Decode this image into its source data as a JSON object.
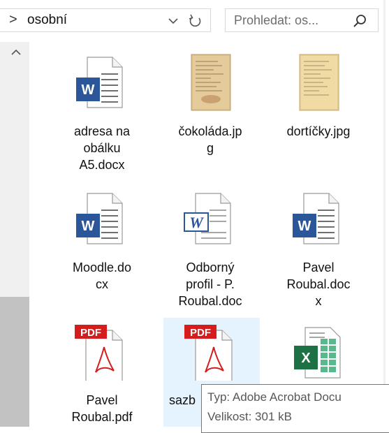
{
  "address_bar": {
    "separator": ">",
    "current_folder": "osobní"
  },
  "search": {
    "placeholder": "Prohledat: os..."
  },
  "files": [
    {
      "name": "adresa na obálku A5.docx",
      "lines": [
        "adresa na",
        "obálku",
        "A5.docx"
      ],
      "icon": "word-doc-icon"
    },
    {
      "name": "čokoláda.jpg",
      "lines": [
        "čokoláda.jp",
        "g"
      ],
      "icon": "image-thumbnail-icon"
    },
    {
      "name": "dortíčky.jpg",
      "lines": [
        "dortíčky.jpg"
      ],
      "icon": "image-thumbnail-icon"
    },
    {
      "name": "Moodle.docx",
      "lines": [
        "Moodle.do",
        "cx"
      ],
      "icon": "word-doc-icon"
    },
    {
      "name": "Odborný profil - P. Roubal.doc",
      "lines": [
        "Odborný",
        "profil - P.",
        "Roubal.doc"
      ],
      "icon": "word-legacy-doc-icon"
    },
    {
      "name": "Pavel Roubal.docx",
      "lines": [
        "Pavel",
        "Roubal.doc",
        "x"
      ],
      "icon": "word-doc-icon"
    },
    {
      "name": "Pavel Roubal.pdf",
      "lines": [
        "Pavel",
        "Roubal.pdf"
      ],
      "icon": "pdf-icon"
    },
    {
      "name": "sazb",
      "lines": [
        "sazb"
      ],
      "icon": "pdf-icon",
      "selected": true
    },
    {
      "name": "",
      "lines": [],
      "icon": "excel-icon"
    }
  ],
  "tooltip": {
    "type_line": "Typ: Adobe Acrobat Docu",
    "size_line": "Velikost: 301 kB"
  },
  "colors": {
    "word_blue": "#2b579a",
    "pdf_red": "#d61d1d",
    "excel_green": "#1e7145",
    "selection": "#e5f3ff"
  }
}
